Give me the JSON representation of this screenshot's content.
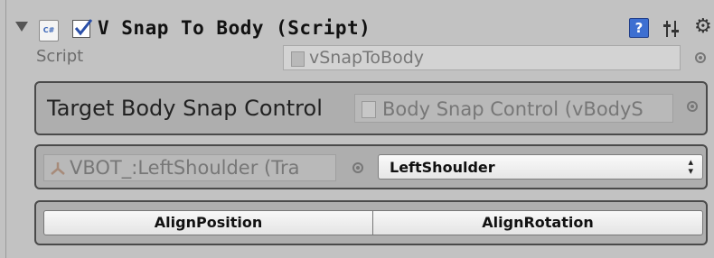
{
  "component": {
    "title": "V Snap To Body (Script)",
    "enabled": true,
    "cs_icon_text": "C#"
  },
  "icons": {
    "help": "help-icon",
    "presets": "presets-icon",
    "gear": "gear-icon"
  },
  "script_row": {
    "label": "Script",
    "value": "vSnapToBody"
  },
  "target_row": {
    "label": "Target Body Snap Control",
    "value": "Body Snap Control (vBodyS"
  },
  "bone_row": {
    "transform_value": "VBOT_:LeftShoulder (Tra",
    "dropdown_value": "LeftShoulder"
  },
  "buttons": {
    "align_position": "AlignPosition",
    "align_rotation": "AlignRotation"
  },
  "colors": {
    "panel_bg": "#c2c2c2",
    "help_blue": "#3d6fd1",
    "box_border": "#4a4a4a"
  }
}
